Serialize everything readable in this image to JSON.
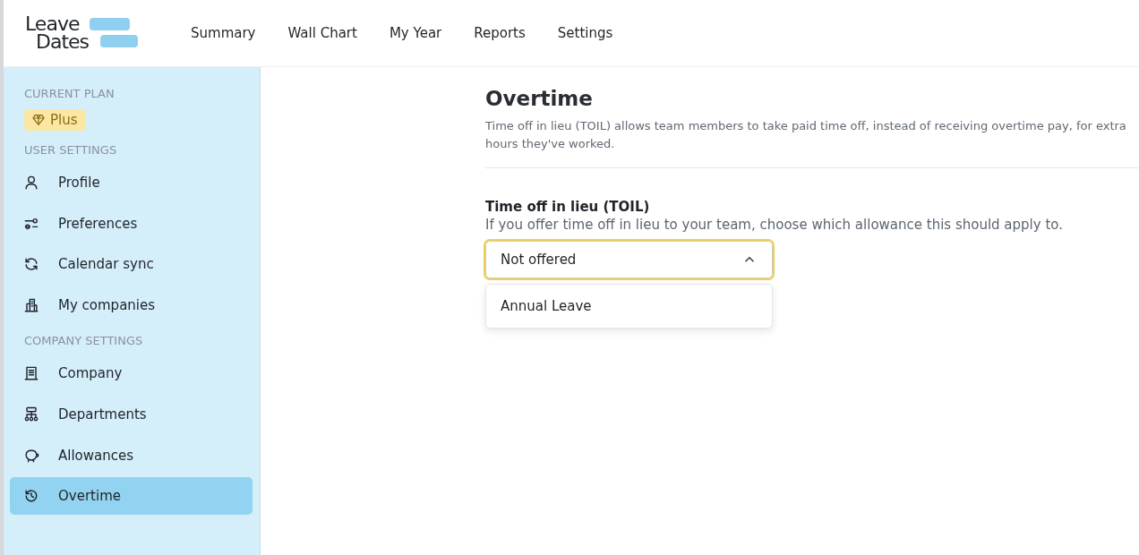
{
  "logo": {
    "line_1": "Leave",
    "line_2": "Dates"
  },
  "nav": [
    {
      "label": "Summary"
    },
    {
      "label": "Wall Chart"
    },
    {
      "label": "My Year"
    },
    {
      "label": "Reports"
    },
    {
      "label": "Settings"
    }
  ],
  "sidebar": {
    "plan": {
      "heading": "CURRENT PLAN",
      "badge": "Plus"
    },
    "sections": [
      {
        "heading": "USER SETTINGS",
        "items": [
          {
            "label": "Profile",
            "selected": false
          },
          {
            "label": "Preferences",
            "selected": false
          },
          {
            "label": "Calendar sync",
            "selected": false
          },
          {
            "label": "My companies",
            "selected": false
          }
        ]
      },
      {
        "heading": "COMPANY SETTINGS",
        "items": [
          {
            "label": "Company",
            "selected": false
          },
          {
            "label": "Departments",
            "selected": false
          },
          {
            "label": "Allowances",
            "selected": false
          },
          {
            "label": "Overtime",
            "selected": true
          }
        ]
      }
    ]
  },
  "page": {
    "title": "Overtime",
    "description": "Time off in lieu (TOIL) allows team members to take paid time off, instead of receiving overtime pay, for extra hours they've worked.",
    "field": {
      "label": "Time off in lieu (TOIL)",
      "help": "If you offer time off in lieu to your team, choose which allowance this should apply to.",
      "value": "Not offered",
      "expanded": true,
      "options": [
        "Annual Leave"
      ]
    }
  }
}
